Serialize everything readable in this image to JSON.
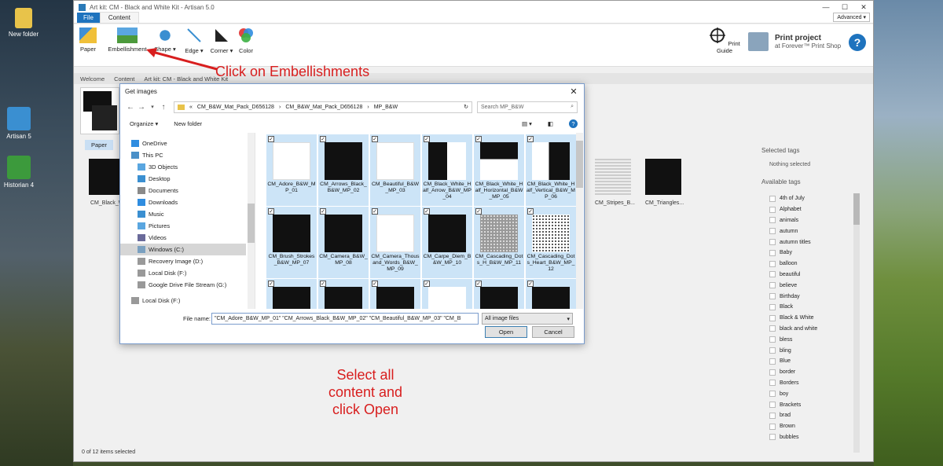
{
  "desktop": {
    "icons": [
      {
        "label": "New folder",
        "icon": "folder-icon"
      },
      {
        "label": "Artisan 5",
        "icon": "artisan-icon"
      },
      {
        "label": "Historian 4",
        "icon": "historian-icon"
      }
    ]
  },
  "app": {
    "title": "Art kit: CM - Black and White Kit - Artisan 5.0",
    "menu": {
      "file": "File",
      "content": "Content",
      "advanced": "Advanced"
    },
    "ribbon": {
      "paper": "Paper",
      "embellishment": "Embellishment",
      "shape": "Shape ▾",
      "edge": "Edge ▾",
      "corner": "Corner ▾",
      "color": "Color",
      "print_guide": "Print Guide",
      "print_project_title": "Print project",
      "print_project_sub": "at Forever™ Print Shop"
    },
    "tabs": [
      "Welcome",
      "Content",
      "Art kit: CM - Black and White Kit"
    ],
    "paper_tab": "Paper",
    "content_items": [
      {
        "name": "CM_Black_W..."
      },
      {
        "name": "CM_Stripes_B..."
      },
      {
        "name": "CM_Triangles..."
      }
    ],
    "selected_tags_label": "Selected tags",
    "nothing_selected": "Nothing selected",
    "available_tags_label": "Available tags",
    "tags": [
      "4th of July",
      "Alphabet",
      "animals",
      "autumn",
      "autumn titles",
      "Baby",
      "balloon",
      "beautiful",
      "believe",
      "Birthday",
      "Black",
      "Black & White",
      "black and white",
      "bless",
      "bling",
      "Blue",
      "border",
      "Borders",
      "boy",
      "Brackets",
      "brad",
      "Brown",
      "bubbles"
    ],
    "status": "0 of 12 items selected"
  },
  "dialog": {
    "title": "Get images",
    "path": [
      "«",
      "CM_B&W_Mat_Pack_D656128",
      "›",
      "CM_B&W_Mat_Pack_D656128",
      "›",
      "MP_B&W"
    ],
    "search_placeholder": "Search MP_B&W",
    "organize": "Organize ▾",
    "new_folder": "New folder",
    "nav": [
      {
        "label": "OneDrive",
        "indent": 1
      },
      {
        "label": "This PC",
        "indent": 1
      },
      {
        "label": "3D Objects",
        "indent": 2
      },
      {
        "label": "Desktop",
        "indent": 2
      },
      {
        "label": "Documents",
        "indent": 2
      },
      {
        "label": "Downloads",
        "indent": 2
      },
      {
        "label": "Music",
        "indent": 2
      },
      {
        "label": "Pictures",
        "indent": 2
      },
      {
        "label": "Videos",
        "indent": 2
      },
      {
        "label": "Windows (C:)",
        "indent": 2
      },
      {
        "label": "Recovery Image (D:)",
        "indent": 2
      },
      {
        "label": "Local Disk (F:)",
        "indent": 2
      },
      {
        "label": "Google Drive File Stream (G:)",
        "indent": 2
      },
      {
        "label": "Local Disk (F:)",
        "indent": 1
      }
    ],
    "files": [
      "CM_Adore_B&W_MP_01",
      "CM_Arrows_Black_B&W_MP_02",
      "CM_Beautiful_B&W_MP_03",
      "CM_Black_White_Half_Arrow_B&W_MP_04",
      "CM_Black_White_Half_Horizontal_B&W_MP_05",
      "CM_Black_White_Half_Vertical_B&W_MP_06",
      "CM_Brush_Strokes_B&W_MP_07",
      "CM_Camera_B&W_MP_08",
      "CM_Camera_Thousand_Words_B&W_MP_09",
      "CM_Carpe_Diem_B&W_MP_10",
      "CM_Cascading_Dots_H_B&W_MP_11",
      "CM_Cascading_Dots_Heart_B&W_MP_12"
    ],
    "file_name_label": "File name:",
    "file_name_value": "\"CM_Adore_B&W_MP_01\" \"CM_Arrows_Black_B&W_MP_02\" \"CM_Beautiful_B&W_MP_03\" \"CM_B",
    "filter": "All image files",
    "open": "Open",
    "cancel": "Cancel"
  },
  "annotations": {
    "click_embellishments": "Click on Embellishments",
    "select_all": [
      "Select all",
      "content and",
      "click Open"
    ]
  },
  "colors": {
    "accent": "#1e73be",
    "annotation": "#d81e1e",
    "selection": "#cce4f7"
  }
}
